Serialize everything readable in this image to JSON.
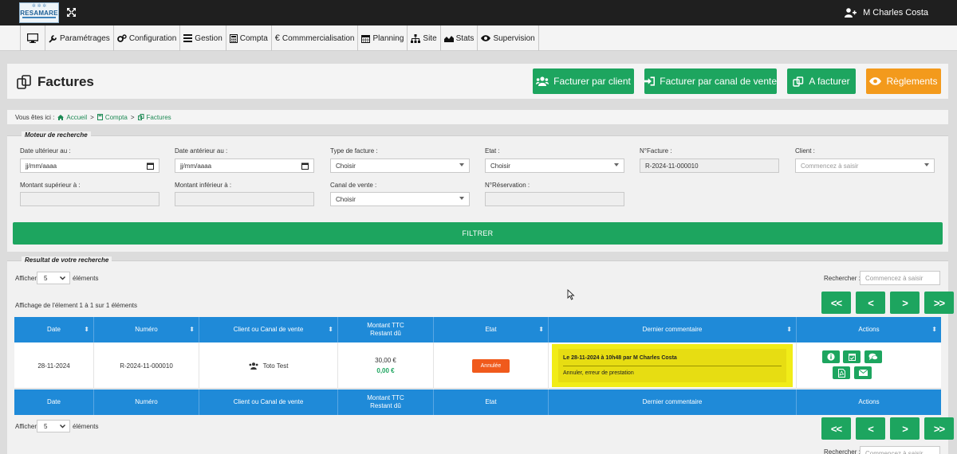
{
  "app": {
    "logo_text": "RESAMARE",
    "user_name": "M Charles Costa",
    "fullscreen_icon": "fullscreen-icon",
    "user_icon": "user-add-icon"
  },
  "menu": [
    {
      "icon": "monitor-icon",
      "label": ""
    },
    {
      "icon": "wrench-icon",
      "label": "Paramétrages"
    },
    {
      "icon": "gears-icon",
      "label": "Configuration"
    },
    {
      "icon": "list-icon",
      "label": "Gestion"
    },
    {
      "icon": "calculator-icon",
      "label": "Compta"
    },
    {
      "icon": "euro-icon",
      "label": "Commmercialisation"
    },
    {
      "icon": "calendar-icon",
      "label": "Planning"
    },
    {
      "icon": "sitemap-icon",
      "label": "Site"
    },
    {
      "icon": "area-chart-icon",
      "label": "Stats"
    },
    {
      "icon": "eye-icon",
      "label": "Supervision"
    }
  ],
  "page": {
    "title": "Factures",
    "title_icon": "copy-icon",
    "buttons": {
      "facturer_client": "Facturer par client",
      "facturer_canal": "Facturer par canal de vente",
      "a_facturer": "A facturer",
      "reglements": "Règlements"
    }
  },
  "breadcrumb": {
    "prefix": "Vous êtes ici :",
    "items": [
      "Accueil",
      "Compta",
      "Factures"
    ],
    "separator": ">"
  },
  "search": {
    "legend": "Moteur de recherche",
    "fields": {
      "date_ult": {
        "label": "Date ultérieur au :",
        "placeholder": "jj/mm/aaaa"
      },
      "date_ant": {
        "label": "Date antérieur au :",
        "placeholder": "jj/mm/aaaa"
      },
      "type": {
        "label": "Type de facture :",
        "value": "Choisir"
      },
      "etat": {
        "label": "Etat :",
        "value": "Choisir"
      },
      "num_facture": {
        "label": "N°Facture :",
        "value": "R-2024-11-000010"
      },
      "client": {
        "label": "Client :",
        "placeholder": "Commencez à saisir"
      },
      "montant_sup": {
        "label": "Montant supérieur à :",
        "value": ""
      },
      "montant_inf": {
        "label": "Montant inférieur à :",
        "value": ""
      },
      "canal": {
        "label": "Canal de vente :",
        "value": "Choisir"
      },
      "num_reservation": {
        "label": "N°Réservation :",
        "value": ""
      }
    },
    "filter_button": "FILTRER"
  },
  "results": {
    "legend": "Resultat de votre recherche",
    "show_label": "Afficher",
    "show_value": "5",
    "elements_label": "éléments",
    "search_label": "Rechercher :",
    "search_placeholder": "Commencez à saisir",
    "info": "Affichage de l'élement 1 à 1 sur 1 éléments",
    "pager": [
      "<<",
      "<",
      ">",
      ">>"
    ],
    "columns": [
      "Date",
      "Numéro",
      "Client ou Canal de vente",
      "Montant TTC\nRestant dû",
      "Etat",
      "Dernier commentaire",
      "Actions"
    ],
    "rows": [
      {
        "date": "28-11-2024",
        "numero": "R-2024-11-000010",
        "client": "Toto Test",
        "montant": "30,00 €",
        "restant": "0,00 €",
        "etat": "Annulée",
        "comment_title": "Le 28-11-2024 à 10h48 par M Charles Costa",
        "comment_text": "Annuler, erreur de prestation"
      }
    ]
  },
  "colors": {
    "green": "#1da55f",
    "orange": "#f39a1c",
    "blue": "#1f8ad8",
    "red_badge": "#f05a1c",
    "highlight": "#f1ec18"
  }
}
